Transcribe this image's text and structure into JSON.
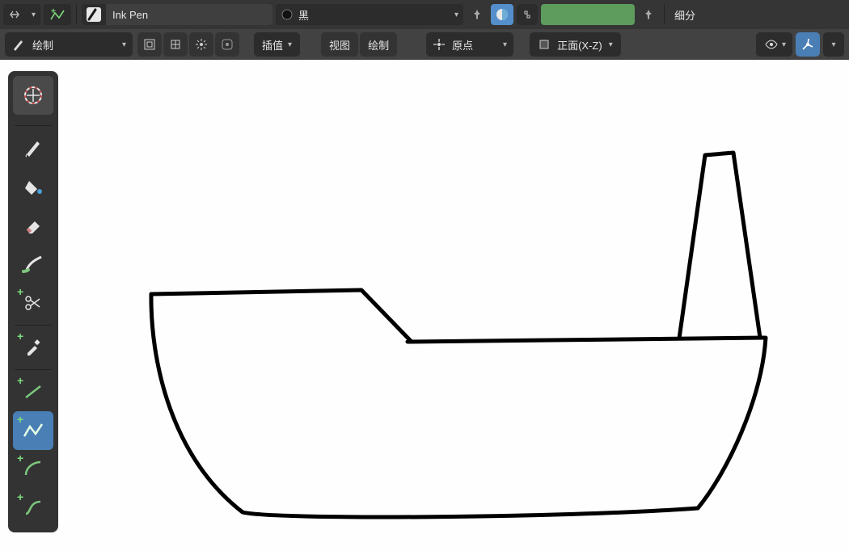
{
  "topbar": {
    "brush_name": "Ink Pen",
    "material_label": "黑",
    "right_label": "细分"
  },
  "header": {
    "mode_label": "绘制",
    "interp_label": "插值",
    "view_btn": "视图",
    "draw_btn": "绘制",
    "origin_label": "原点",
    "front_label": "正面(X-Z)"
  },
  "tools": {
    "cursor": "3d-cursor",
    "draw": "draw",
    "fill": "fill",
    "erase": "erase",
    "tint": "tint",
    "cutter": "cutter",
    "eyedropper": "eyedropper",
    "line": "line",
    "polyline": "polyline",
    "arc": "arc",
    "curve": "curve"
  }
}
